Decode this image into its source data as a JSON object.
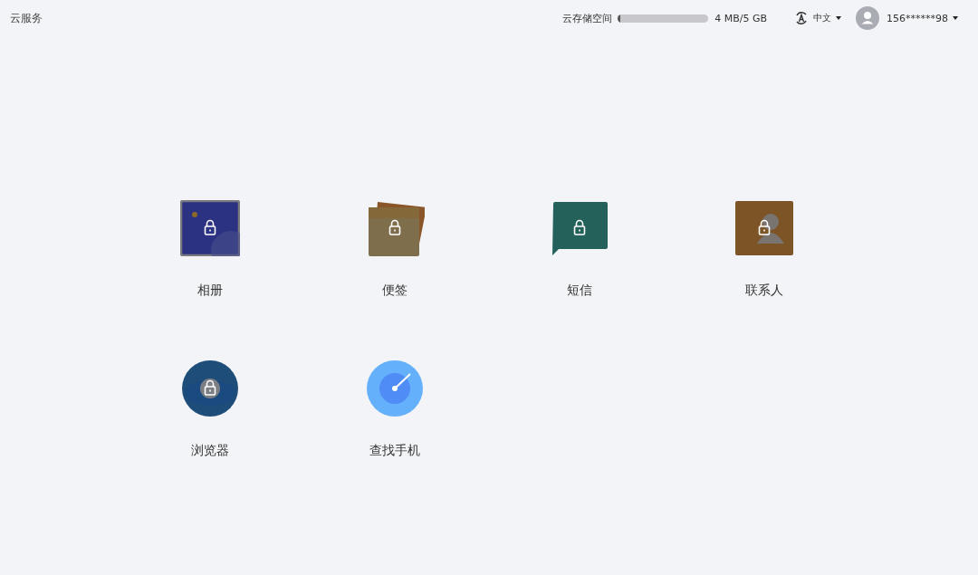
{
  "header": {
    "title": "云服务",
    "storage": {
      "label": "云存储空间",
      "level": 0.01,
      "reading": "4 MB/5 GB"
    },
    "language": "中文",
    "account": "156******98"
  },
  "apps": [
    {
      "label": "相册",
      "kind": "gallery",
      "locked": true
    },
    {
      "label": "便签",
      "kind": "notes",
      "locked": true
    },
    {
      "label": "短信",
      "kind": "messages",
      "locked": true
    },
    {
      "label": "联系人",
      "kind": "contacts",
      "locked": true
    },
    {
      "label": "浏览器",
      "kind": "browser",
      "locked": true
    },
    {
      "label": "查找手机",
      "kind": "findphone",
      "locked": false
    }
  ]
}
